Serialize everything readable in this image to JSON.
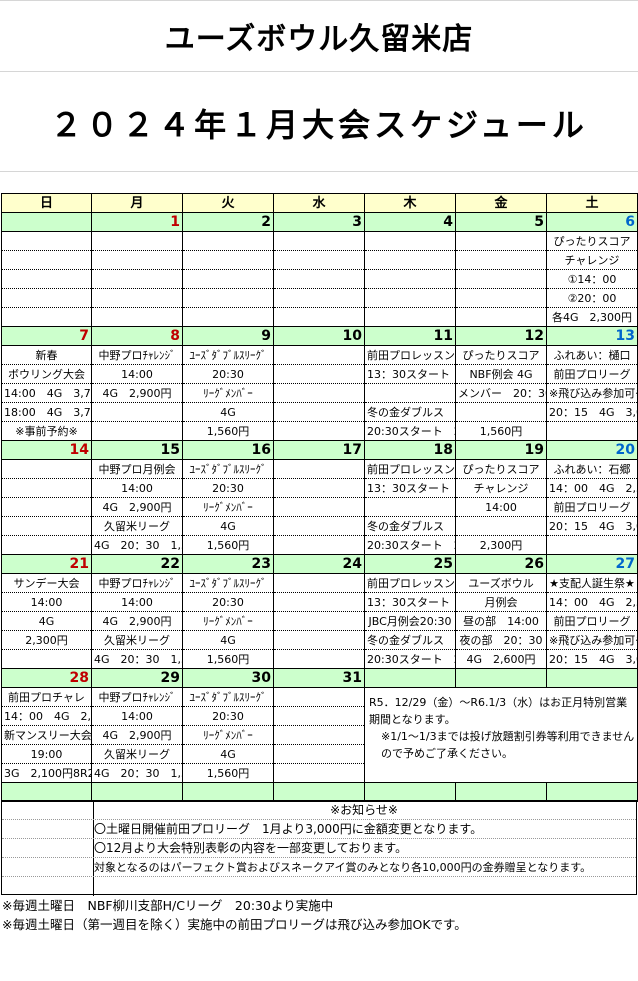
{
  "title": {
    "store": "ユーズボウル久留米店",
    "schedule": "２０２４年１月大会スケジュール"
  },
  "weekdays": [
    "日",
    "月",
    "火",
    "水",
    "木",
    "金",
    "土"
  ],
  "weeks": [
    {
      "dates": [
        "",
        "1",
        "2",
        "3",
        "4",
        "5",
        "6"
      ],
      "rows": [
        [
          "",
          "",
          "",
          "",
          "",
          "",
          "ぴったりスコア"
        ],
        [
          "",
          "",
          "",
          "",
          "",
          "",
          "チャレンジ"
        ],
        [
          "",
          "",
          "",
          "",
          "",
          "",
          "①14：00"
        ],
        [
          "",
          "",
          "",
          "",
          "",
          "",
          "②20：00"
        ],
        [
          "",
          "",
          "",
          "",
          "",
          "",
          "各4G　2,300円"
        ]
      ]
    },
    {
      "dates": [
        "7",
        "8",
        "9",
        "10",
        "11",
        "12",
        "13"
      ],
      "rows": [
        [
          "新春",
          "中野プロﾁｬﾚﾝｼﾞ",
          "ﾕｰｽﾞﾀﾞﾌﾞﾙｽﾘｰｸﾞ",
          "",
          "前田プロレッスンリーグ",
          "ぴったりスコア",
          "ふれあい：樋口"
        ],
        [
          "ボウリング大会",
          "14:00",
          "20:30",
          "",
          "13：30スタート　2,000円",
          "NBF例会 4G",
          "前田プロリーグ"
        ],
        [
          "14:00　4G　3,700円",
          "4G　2,900円",
          "ﾘｰｸﾞﾒﾝﾊﾞｰ",
          "",
          "",
          "メンバー　20：30",
          "※飛び込み参加可※"
        ],
        [
          "18:00　4G　3,700円",
          "",
          "4G",
          "",
          "冬の金ダブルス　　4G",
          "",
          "20：15　4G　3,000円"
        ],
        [
          "※事前予約※",
          "",
          "1,560円",
          "",
          "20:30スタート　2,100円",
          "1,560円",
          ""
        ]
      ]
    },
    {
      "dates": [
        "14",
        "15",
        "16",
        "17",
        "18",
        "19",
        "20"
      ],
      "rows": [
        [
          "",
          "中野プロ月例会",
          "ﾕｰｽﾞﾀﾞﾌﾞﾙｽﾘｰｸﾞ",
          "",
          "前田プロレッスンリーグ",
          "ぴったりスコア",
          "ふれあい：石郷"
        ],
        [
          "",
          "14:00",
          "20:30",
          "",
          "13：30スタート　2,000円",
          "チャレンジ",
          "14：00　4G　2,300円"
        ],
        [
          "",
          "4G　2,900円",
          "ﾘｰｸﾞﾒﾝﾊﾞｰ",
          "",
          "",
          "14:00",
          "前田プロリーグ"
        ],
        [
          "",
          "久留米リーグ",
          "4G",
          "",
          "冬の金ダブルス　　4G",
          "",
          "20：15　4G　3,000円"
        ],
        [
          "",
          "4G　20：30　1,560円",
          "1,560円",
          "",
          "20:30スタート　2,100円",
          "2,300円",
          ""
        ]
      ]
    },
    {
      "dates": [
        "21",
        "22",
        "23",
        "24",
        "25",
        "26",
        "27"
      ],
      "rows": [
        [
          "サンデー大会",
          "中野プロﾁｬﾚﾝｼﾞ",
          "ﾕｰｽﾞﾀﾞﾌﾞﾙｽﾘｰｸﾞ",
          "",
          "前田プロレッスンリーグ",
          "ユーズボウル",
          "★支配人誕生祭★"
        ],
        [
          "14:00",
          "14:00",
          "20:30",
          "",
          "13：30スタート　2,000円",
          "月例会",
          "14：00　4G　2,300円"
        ],
        [
          "4G",
          "4G　2,900円",
          "ﾘｰｸﾞﾒﾝﾊﾞｰ",
          "",
          "JBC月例会20:30",
          "昼の部　14:00",
          "前田プロリーグ"
        ],
        [
          "2,300円",
          "久留米リーグ",
          "4G",
          "",
          "冬の金ダブルス　　4G",
          "夜の部　20：30",
          "※飛び込み参加可※"
        ],
        [
          "",
          "4G　20：30　1,560円",
          "1,560円",
          "",
          "20:30スタート　2,100円",
          "4G　2,600円",
          "20：15　4G　3,000円"
        ]
      ]
    },
    {
      "dates": [
        "28",
        "29",
        "30",
        "31",
        "",
        "",
        ""
      ],
      "rows": [
        [
          "前田プロチャレ",
          "中野プロﾁｬﾚﾝｼﾞ",
          "ﾕｰｽﾞﾀﾞﾌﾞﾙｽﾘｰｸﾞ",
          ""
        ],
        [
          "14：00　4G　2,900円",
          "14:00",
          "20:30",
          ""
        ],
        [
          "新マンスリー大会",
          "4G　2,900円",
          "ﾘｰｸﾞﾒﾝﾊﾞｰ",
          ""
        ],
        [
          "19:00",
          "久留米リーグ",
          "4G",
          ""
        ],
        [
          "3G　2,100円8R2,600円",
          "4G　20：30　1,560円",
          "1,560円",
          ""
        ]
      ],
      "note": {
        "line1": "R5．12/29（金）～R6.1/3（水）はお正月特別営業期間となります。",
        "line2": "※1/1～1/3までは投げ放題割引券等利用できませんので予めご了承ください。"
      }
    }
  ],
  "news": {
    "title": "※お知らせ※",
    "items": [
      "〇土曜日開催前田プロリーグ　1月より3,000円に金額変更となります。",
      "〇12月より大会特別表彰の内容を一部変更しております。",
      "対象となるのはパーフェクト賞およびスネークアイ賞のみとなり各10,000円の金券贈呈となります。"
    ]
  },
  "footer": [
    "※毎週土曜日　NBF柳川支部H/Cリーグ　20:30より実施中",
    "※毎週土曜日（第一週目を除く）実施中の前田プロリーグは飛び込み参加OKです。"
  ],
  "colors": {
    "header_bg": "#ffffcc",
    "date_row_bg": "#ccffcc",
    "sunday": "#c00000",
    "saturday": "#0066cc"
  }
}
